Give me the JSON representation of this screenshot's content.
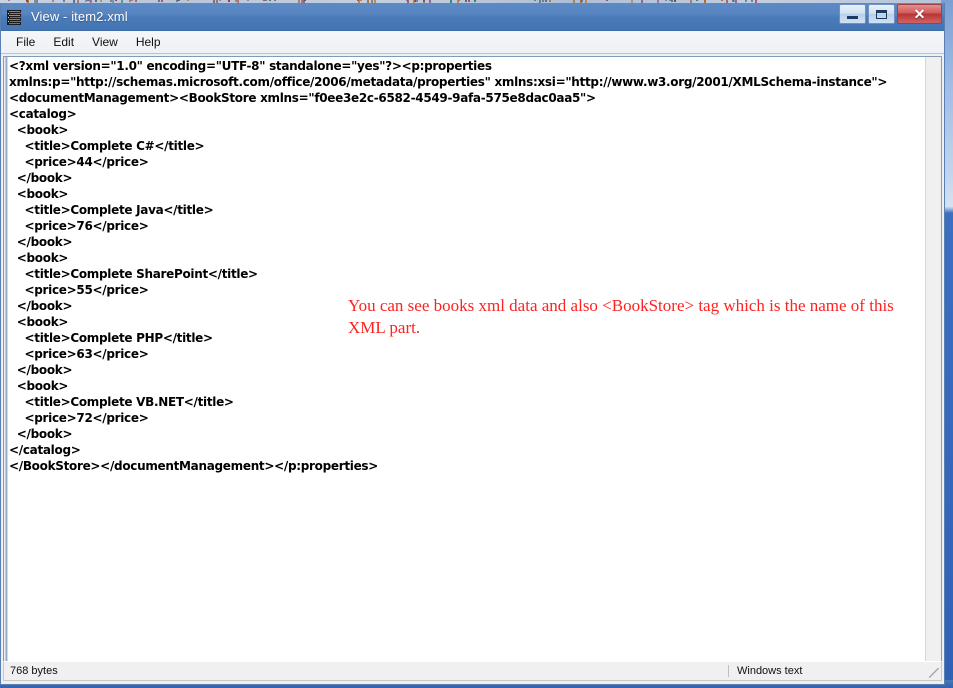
{
  "window": {
    "title": "View - item2.xml",
    "icon": "book-stack-icon",
    "controls": {
      "minimize_label": "–",
      "maximize_label": "□",
      "close_label": "✕"
    }
  },
  "menubar": {
    "items": [
      {
        "label": "File"
      },
      {
        "label": "Edit"
      },
      {
        "label": "View"
      },
      {
        "label": "Help"
      }
    ]
  },
  "editor": {
    "xml_content": "<?xml version=\"1.0\" encoding=\"UTF-8\" standalone=\"yes\"?><p:properties\nxmlns:p=\"http://schemas.microsoft.com/office/2006/metadata/properties\" xmlns:xsi=\"http://www.w3.org/2001/XMLSchema-instance\">\n<documentManagement><BookStore xmlns=\"f0ee3e2c-6582-4549-9afa-575e8dac0aa5\">\n<catalog>\n  <book>\n    <title>Complete C#</title>\n    <price>44</price>\n  </book>\n  <book>\n    <title>Complete Java</title>\n    <price>76</price>\n  </book>\n  <book>\n    <title>Complete SharePoint</title>\n    <price>55</price>\n  </book>\n  <book>\n    <title>Complete PHP</title>\n    <price>63</price>\n  </book>\n  <book>\n    <title>Complete VB.NET</title>\n    <price>72</price>\n  </book>\n</catalog>\n</BookStore></documentManagement></p:properties>",
    "xml_declaration": {
      "version": "1.0",
      "encoding": "UTF-8",
      "standalone": "yes"
    },
    "namespaces": {
      "p": "http://schemas.microsoft.com/office/2006/metadata/properties",
      "xsi": "http://www.w3.org/2001/XMLSchema-instance",
      "bookstore_default": "f0ee3e2c-6582-4549-9afa-575e8dac0aa5"
    },
    "catalog": [
      {
        "title": "Complete C#",
        "price": "44"
      },
      {
        "title": "Complete Java",
        "price": "76"
      },
      {
        "title": "Complete SharePoint",
        "price": "55"
      },
      {
        "title": "Complete PHP",
        "price": "63"
      },
      {
        "title": "Complete VB.NET",
        "price": "72"
      }
    ],
    "annotation": {
      "text": "You can see books xml data and also <BookStore> tag which is the name of this XML part.",
      "color": "#ff2222"
    }
  },
  "statusbar": {
    "size_text": "768 bytes",
    "encoding_text": "Windows text"
  },
  "colors": {
    "titlebar_blue": "#4a7ab8",
    "close_red": "#bb3232",
    "annotation_red": "#ff2222",
    "editor_background": "#ffffff",
    "chrome_background": "#f0f0f0"
  }
}
